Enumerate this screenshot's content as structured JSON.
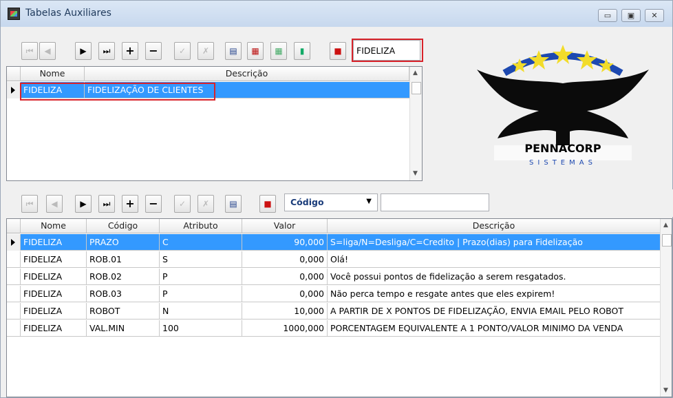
{
  "window": {
    "title": "Tabelas Auxiliares",
    "minimize_glyph": "▭",
    "maximize_glyph": "▣",
    "close_glyph": "✕"
  },
  "top_toolbar": {
    "search_value": "FIDELIZA"
  },
  "top_grid": {
    "columns": [
      "Nome",
      "Descrição"
    ],
    "rows": [
      {
        "nome": "FIDELIZA",
        "descricao": "FIDELIZAÇÃO DE CLIENTES",
        "selected": true
      }
    ]
  },
  "logo": {
    "text": "PENNACORP",
    "subtext": "SISTEMAS"
  },
  "bottom_toolbar": {
    "field_select": "Código",
    "search_value": ""
  },
  "bottom_grid": {
    "columns": [
      "Nome",
      "Código",
      "Atributo",
      "Valor",
      "Descrição"
    ],
    "rows": [
      {
        "nome": "FIDELIZA",
        "codigo": "PRAZO",
        "atributo": "C",
        "valor": "90,000",
        "descricao": "S=liga/N=Desliga/C=Credito | Prazo(dias) para Fidelização",
        "selected": true
      },
      {
        "nome": "FIDELIZA",
        "codigo": "ROB.01",
        "atributo": "S",
        "valor": "0,000",
        "descricao": "Olá!"
      },
      {
        "nome": "FIDELIZA",
        "codigo": "ROB.02",
        "atributo": "P",
        "valor": "0,000",
        "descricao": "Você possui pontos de fidelização a serem resgatados."
      },
      {
        "nome": "FIDELIZA",
        "codigo": "ROB.03",
        "atributo": "P",
        "valor": "0,000",
        "descricao": "Não perca tempo e resgate antes que eles expirem!"
      },
      {
        "nome": "FIDELIZA",
        "codigo": "ROBOT",
        "atributo": "N",
        "valor": "10,000",
        "descricao": "A PARTIR DE X PONTOS DE FIDELIZAÇÃO, ENVIA EMAIL PELO ROBOT"
      },
      {
        "nome": "FIDELIZA",
        "codigo": "VAL.MIN",
        "atributo": "100",
        "valor": "1000,000",
        "descricao": "PORCENTAGEM EQUIVALENTE A 1 PONTO/VALOR MINIMO DA VENDA"
      }
    ]
  },
  "colors": {
    "selection": "#3399ff",
    "highlight_box": "#d8222a",
    "logo_stars": "#f2dc2a",
    "logo_arc": "#1d49b0"
  }
}
